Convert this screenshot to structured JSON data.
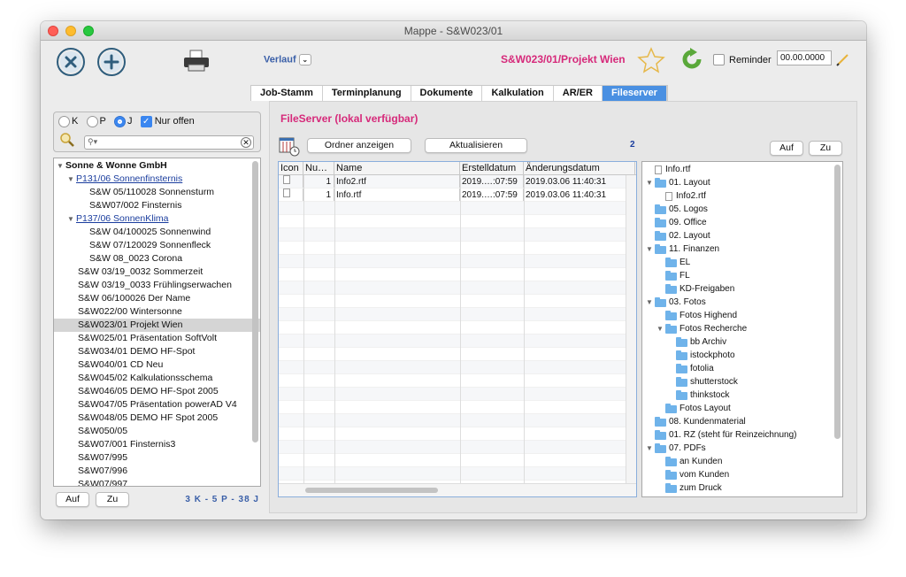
{
  "window": {
    "title": "Mappe - S&W023/01"
  },
  "toolbar": {
    "verlauf_label": "Verlauf",
    "project_label": "S&W023/01/Projekt Wien",
    "reminder_label": "Reminder",
    "reminder_date": "00.00.0000"
  },
  "tabs": [
    "Job-Stamm",
    "Terminplanung",
    "Dokumente",
    "Kalkulation",
    "AR/ER",
    "Fileserver"
  ],
  "active_tab": "Fileserver",
  "filter": {
    "radio_k": "K",
    "radio_p": "P",
    "radio_j": "J",
    "nur_offen_label": "Nur offen",
    "search_value": ""
  },
  "job_tree": {
    "root": "Sonne & Wonne GmbH",
    "groups": [
      {
        "label": "P131/06 Sonnenfinsternis",
        "children": [
          "S&W 05/110028 Sonnensturm",
          "S&W07/002 Finsternis"
        ]
      },
      {
        "label": "P137/06 SonnenKlima",
        "children": [
          "S&W 04/100025 Sonnenwind",
          "S&W 07/120029 Sonnenfleck",
          "S&W 08_0023 Corona"
        ]
      }
    ],
    "jobs": [
      "S&W 03/19_0032 Sommerzeit",
      "S&W 03/19_0033 Frühlingserwachen",
      "S&W 06/100026 Der Name",
      "S&W022/00 Wintersonne",
      "S&W023/01 Projekt Wien",
      "S&W025/01 Präsentation SoftVolt",
      "S&W034/01 DEMO HF-Spot",
      "S&W040/01 CD Neu",
      "S&W045/02 Kalkulationsschema",
      "S&W046/05 DEMO HF-Spot 2005",
      "S&W047/05 Präsentation powerAD V4",
      "S&W048/05 DEMO HF Spot 2005",
      "S&W050/05",
      "S&W07/001 Finsternis3",
      "S&W07/995",
      "S&W07/996",
      "S&W07/997"
    ],
    "selected": "S&W023/01 Projekt Wien"
  },
  "left_footer": {
    "auf_label": "Auf",
    "zu_label": "Zu",
    "counts": "3 K - 5 P - 38 J"
  },
  "fileserver": {
    "title": "FileServer (lokal verfügbar)",
    "ordner_button": "Ordner anzeigen",
    "aktualisieren_button": "Aktualisieren",
    "count": "2",
    "auf_label": "Auf",
    "zu_label": "Zu",
    "columns": [
      "Icon",
      "Nu…",
      "Name",
      "Erstelldatum",
      "Änderungsdatum"
    ],
    "rows": [
      {
        "num": "1",
        "name": "Info2.rtf",
        "created": "2019.…:07:59",
        "modified": "2019.03.06 11:40:31"
      },
      {
        "num": "1",
        "name": "Info.rtf",
        "created": "2019.…:07:59",
        "modified": "2019.03.06 11:40:31"
      }
    ]
  },
  "folder_tree": [
    {
      "label": "Info.rtf",
      "type": "file",
      "depth": 0,
      "arrow": ""
    },
    {
      "label": "01. Layout",
      "type": "folder",
      "depth": 0,
      "arrow": "▼"
    },
    {
      "label": "Info2.rtf",
      "type": "file",
      "depth": 1,
      "arrow": ""
    },
    {
      "label": "05. Logos",
      "type": "folder",
      "depth": 0,
      "arrow": ""
    },
    {
      "label": "09. Office",
      "type": "folder",
      "depth": 0,
      "arrow": ""
    },
    {
      "label": "02. Layout",
      "type": "folder",
      "depth": 0,
      "arrow": ""
    },
    {
      "label": "11. Finanzen",
      "type": "folder",
      "depth": 0,
      "arrow": "▼"
    },
    {
      "label": "EL",
      "type": "folder",
      "depth": 1,
      "arrow": ""
    },
    {
      "label": "FL",
      "type": "folder",
      "depth": 1,
      "arrow": ""
    },
    {
      "label": "KD-Freigaben",
      "type": "folder",
      "depth": 1,
      "arrow": ""
    },
    {
      "label": "03. Fotos",
      "type": "folder",
      "depth": 0,
      "arrow": "▼"
    },
    {
      "label": "Fotos Highend",
      "type": "folder",
      "depth": 1,
      "arrow": ""
    },
    {
      "label": "Fotos Recherche",
      "type": "folder",
      "depth": 1,
      "arrow": "▼"
    },
    {
      "label": "bb Archiv",
      "type": "folder",
      "depth": 2,
      "arrow": ""
    },
    {
      "label": "istockphoto",
      "type": "folder",
      "depth": 2,
      "arrow": ""
    },
    {
      "label": "fotolia",
      "type": "folder",
      "depth": 2,
      "arrow": ""
    },
    {
      "label": "shutterstock",
      "type": "folder",
      "depth": 2,
      "arrow": ""
    },
    {
      "label": "thinkstock",
      "type": "folder",
      "depth": 2,
      "arrow": ""
    },
    {
      "label": "Fotos Layout",
      "type": "folder",
      "depth": 1,
      "arrow": ""
    },
    {
      "label": "08. Kundenmaterial",
      "type": "folder",
      "depth": 0,
      "arrow": ""
    },
    {
      "label": "01. RZ (steht für Reinzeichnung)",
      "type": "folder",
      "depth": 0,
      "arrow": ""
    },
    {
      "label": "07. PDFs",
      "type": "folder",
      "depth": 0,
      "arrow": "▼"
    },
    {
      "label": "an Kunden",
      "type": "folder",
      "depth": 1,
      "arrow": ""
    },
    {
      "label": "vom Kunden",
      "type": "folder",
      "depth": 1,
      "arrow": ""
    },
    {
      "label": "zum Druck",
      "type": "folder",
      "depth": 1,
      "arrow": ""
    }
  ],
  "colors": {
    "accent_pink": "#d6297a",
    "link_blue": "#1a3d9e",
    "tab_active": "#4a90e2"
  }
}
